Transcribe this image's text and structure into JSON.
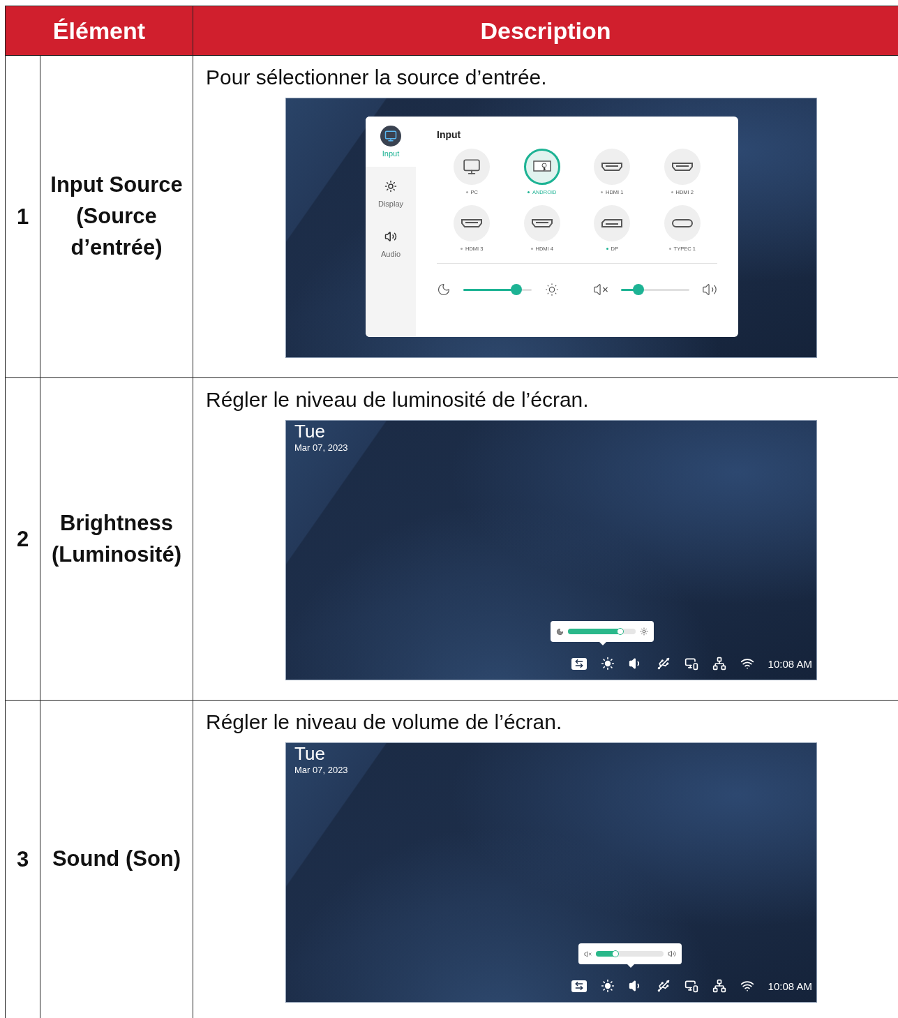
{
  "table": {
    "columns": [
      "Élément",
      "Description"
    ],
    "rows": [
      {
        "number": "1",
        "element": "Input Source (Source d’entrée)",
        "description": "Pour sélectionner la source d’entrée.",
        "screen": {
          "kind": "input_menu",
          "sidebar": [
            {
              "label": "Input",
              "selected": true
            },
            {
              "label": "Display",
              "selected": false
            },
            {
              "label": "Audio",
              "selected": false
            }
          ],
          "title": "Input",
          "sources": [
            {
              "kind": "pc",
              "label": "PC",
              "selected": false,
              "signal": false
            },
            {
              "kind": "android",
              "label": "ANDROID",
              "selected": true,
              "signal": true
            },
            {
              "kind": "hdmi",
              "label": "HDMI 1",
              "selected": false,
              "signal": false
            },
            {
              "kind": "hdmi",
              "label": "HDMI 2",
              "selected": false,
              "signal": false
            },
            {
              "kind": "hdmi",
              "label": "HDMI 3",
              "selected": false,
              "signal": false
            },
            {
              "kind": "hdmi",
              "label": "HDMI 4",
              "selected": false,
              "signal": false
            },
            {
              "kind": "dp",
              "label": "DP",
              "selected": false,
              "signal": true
            },
            {
              "kind": "typec",
              "label": "TYPEC 1",
              "selected": false,
              "signal": false
            }
          ],
          "brightness": {
            "level": 0.78
          },
          "volume": {
            "level": 0.25
          }
        }
      },
      {
        "number": "2",
        "element": "Brightness (Luminosité)",
        "description": "Régler le niveau de luminosité de l’écran.",
        "screen": {
          "kind": "desktop",
          "day": "Tue",
          "date": "Mar 07, 2023",
          "time": "10:08 AM",
          "popup": {
            "kind": "brightness",
            "level": 0.8
          }
        }
      },
      {
        "number": "3",
        "element": "Sound (Son)",
        "description": "Régler le niveau de volume de l’écran.",
        "screen": {
          "kind": "desktop",
          "day": "Tue",
          "date": "Mar 07, 2023",
          "time": "10:08 AM",
          "popup": {
            "kind": "volume",
            "level": 0.27
          }
        }
      }
    ]
  }
}
